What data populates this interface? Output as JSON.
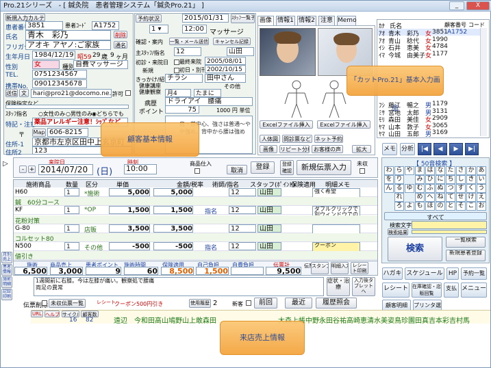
{
  "window": {
    "app": "Pro.21シリーズ",
    "title": "- [ 鍼灸院　患者管理システム「鍼灸Pro.21」 ]",
    "minimize": "_",
    "close": "X"
  },
  "topbar": {
    "register_button": "新規入力カルテ"
  },
  "patient": {
    "no_label": "患者番号",
    "no": "3851",
    "patient_code_label": "患者ｺｰﾄﾞ",
    "patient_code": "A1752",
    "delete": "削除",
    "name_label": "氏名",
    "name": "青木　彩乃",
    "nickname": "通名",
    "furigana_label": "フリガナ",
    "furigana": "アオキ アヤノ:ご家族",
    "birth_label": "生年月日",
    "birth": "1984/12/19",
    "era": "昭59",
    "age": "29",
    "age_unit": "歳",
    "month": "9",
    "month_unit": "ヶ月",
    "sex_label": "性別",
    "sex": "女",
    "category_label": "種別",
    "category": "自費マッサージ",
    "tel_label": "TEL.",
    "tel": "0751234567",
    "mobile_label": "携帯No.",
    "mobile": "09012345678",
    "email_btn": "送信",
    "text_btn": "文",
    "email": "hari@pro21@docomo.ne.jp",
    "permit": "許可",
    "insurance_label": "保険指定など",
    "staff_label": "ｽﾀｯﾌ指名",
    "staff_options": [
      "女性のみ",
      "男性のみ",
      "どちらでも"
    ],
    "alert_label": "特記・注意",
    "alert": "薬品アレルギー注意！ｼｯﾌﾟなど",
    "zip_label": "〒",
    "map": "Map",
    "zip": "606-8215",
    "address_label": "住所-1",
    "address1": "京都市左京区田中上玄京町",
    "address_label2": "住所2",
    "address2": "123"
  },
  "reservation": {
    "reserve_btn": "予約状況",
    "date": "2015/01/31",
    "time": "12:00",
    "menu": "マッサージ",
    "staff_btn": "ｽﾀｯﾌ一覧予約",
    "confirm_label": "確認・案内",
    "mail_send": "一覧・メール送信",
    "cancel": "キャンセル記録",
    "main_staff_label": "主ｽﾀｯﾌ/指名",
    "main_staff_no": "12",
    "main_staff": "山田",
    "first_visit_label": "初診・来院日",
    "first_visit_chk": "最終来院",
    "first_visit": "2005/08/01",
    "new_label": "新規",
    "first": "初日・別刊",
    "last": "2002/10/15",
    "trigger_label": "きっかけ/紹介",
    "trigger": "チラシ",
    "referrer": "田中さん",
    "seminar1": "健康講座",
    "seminar2": "健康観察",
    "col_label": "その他",
    "month_sel": "月4",
    "freq": "たまに",
    "symptom_label": "病歴",
    "symptom": "ドライアイ　腰痛",
    "point_label": "ポイント",
    "points": "75",
    "unit_price": "1000 円 単位",
    "memo_label": "基本情報",
    "memo_text": "肩・首中心、強さは普通〜やや強め。背中から腰は強め"
  },
  "images_tabs": [
    "画像",
    "情報1",
    "情報2",
    "注意",
    "Memo"
  ],
  "images_panel": {
    "excel1": "Excelファイル挿入",
    "excel2": "Excelファイル挿入",
    "body_btn": "人体図",
    "qa_btn": "問診票など",
    "net": "ネット予約",
    "img_btn": "画像",
    "repeat": "リピート分析",
    "feedback": "お客様の声",
    "enlarge": "拡大"
  },
  "customer_list": {
    "header_name": "氏名",
    "header_no": "顧客番号",
    "header_code": "コード",
    "items": [
      {
        "kana": "ｱｵ",
        "name": "青木　彩乃",
        "g": "女",
        "no": "3851",
        "code": "A1752"
      },
      {
        "kana": "ｱｵ",
        "name": "青山　稔代",
        "g": "女",
        "no": "1990"
      },
      {
        "kana": "ｲｼ",
        "name": "石井　恵美",
        "g": "女",
        "no": "4784"
      },
      {
        "kana": "ｲﾏ",
        "name": "今城　由美子",
        "g": "女",
        "no": "1177"
      },
      {
        "kana": "",
        "name": "",
        "g": "",
        "no": ""
      },
      {
        "kana": "",
        "name": "",
        "g": "",
        "no": ""
      },
      {
        "kana": "",
        "name": "",
        "g": "",
        "no": ""
      },
      {
        "kana": "",
        "name": "",
        "g": "",
        "no": ""
      },
      {
        "kana": "",
        "name": "",
        "g": "",
        "no": ""
      },
      {
        "kana": "",
        "name": "",
        "g": "",
        "no": ""
      },
      {
        "kana": "ﾌｼ",
        "name": "藤江　暢之",
        "g": "男",
        "no": "1179"
      },
      {
        "kana": "ﾐｻ",
        "name": "宮地　太郎",
        "g": "男",
        "no": "3131"
      },
      {
        "kana": "ﾓﾘ",
        "name": "森田　美佳",
        "g": "女",
        "no": "2909"
      },
      {
        "kana": "ﾔﾏ",
        "name": "山本　敦子",
        "g": "女",
        "no": "3065"
      },
      {
        "kana": "ﾔﾏ",
        "name": "山田　五郎",
        "g": "男",
        "no": "3169"
      }
    ],
    "memo": "メモ",
    "analysis": "分析",
    "first": "|◀",
    "prev": "◀",
    "next": "▶",
    "last": "▶|"
  },
  "kana_panel": {
    "title": "【 50音検索 】",
    "rows": [
      [
        "わ",
        "ら",
        "や",
        "ま",
        "は",
        "な",
        "た",
        "さ",
        "か",
        "あ"
      ],
      [
        "を",
        "り",
        "",
        "み",
        "ひ",
        "に",
        "ち",
        "し",
        "き",
        "い"
      ],
      [
        "ん",
        "る",
        "ゆ",
        "む",
        "ふ",
        "ぬ",
        "つ",
        "す",
        "く",
        "う"
      ],
      [
        "",
        "れ",
        "",
        "め",
        "へ",
        "ね",
        "て",
        "せ",
        "け",
        "え"
      ],
      [
        "",
        "ろ",
        "よ",
        "も",
        "ほ",
        "の",
        "と",
        "そ",
        "こ",
        "お"
      ]
    ],
    "all": "すべて",
    "search_text": "検索文字",
    "search_result": "検索結果",
    "search": "検索",
    "simple": "一覧検索",
    "new": "新規患者登録"
  },
  "right_buttons": {
    "hagaki": "ハガキ",
    "schedule": "スケジュール",
    "hp": "HP",
    "yoyaku": "予約一覧",
    "receipt": "レシート",
    "receipt_sub": "印刷",
    "ledger": "在庫確認・店販回覧",
    "payment": "支払",
    "menu": "メニュー",
    "staff": "顧客明細",
    "print": "プリンタ選択"
  },
  "visit": {
    "visit_date_label": "来院日",
    "visit_date": "2014/07/20",
    "dow": "(日)",
    "time_label": "時刻",
    "time": "10:00",
    "product_label": "商品仕入",
    "cancel": "取消",
    "register": "登録",
    "check": "登録確認",
    "new_slip": "新規伝票入力",
    "unpaid": "未収"
  },
  "line_header": {
    "item": "施術商品",
    "qty": "数量",
    "kind": "区分",
    "unit": "単価",
    "amount": "金額/税率",
    "staff": "術師/指名",
    "fee": "スタッフ(ﾎﾟｲﾝﾄ)",
    "insurance": "保険適用",
    "memo": "明細メモ"
  },
  "lines": [
    {
      "code": "H60",
      "qty": "1",
      "kind": "*施術",
      "unit": "5,000",
      "amount": "5,000",
      "nomination": "",
      "staff_no": "12",
      "staff": "山田",
      "memo": "強く希望",
      "memo2": "主に右肩"
    },
    {
      "code": "鍼　60分コース",
      "qty": "",
      "kind": "",
      "unit": "",
      "amount": "",
      "nomination": "",
      "staff_no": "",
      "staff": "",
      "memo": ""
    },
    {
      "code": "KF",
      "qty": "1",
      "kind": "*OP",
      "unit": "1,500",
      "amount": "1,500",
      "nomination": "指名",
      "staff_no": "12",
      "staff": "山田",
      "memo": "ダブルクリックで別ウィンドウでの入力も可能です。"
    },
    {
      "code": "花粉対策",
      "qty": "",
      "kind": "",
      "unit": "",
      "amount": "",
      "nomination": "",
      "staff_no": "",
      "staff": "",
      "memo": ""
    },
    {
      "code": "G-80",
      "qty": "1",
      "kind": "店販",
      "unit": "3,500",
      "amount": "3,500",
      "nomination": "",
      "staff_no": "12",
      "staff": "山田",
      "memo": ""
    },
    {
      "code": "コルセット80",
      "qty": "",
      "kind": "",
      "unit": "",
      "amount": "",
      "nomination": "",
      "staff_no": "",
      "staff": "",
      "memo": ""
    },
    {
      "code": "N500",
      "qty": "1",
      "kind": "その他",
      "unit": "-500",
      "amount": "-500",
      "nomination": "指名",
      "staff_no": "12",
      "staff": "山田",
      "memo": "クーポン"
    },
    {
      "code": "値引き",
      "qty": "",
      "kind": "",
      "unit": "",
      "amount": "",
      "nomination": "",
      "staff_no": "",
      "staff": "",
      "memo": ""
    }
  ],
  "totals": {
    "t_label": "施術",
    "t": "6,500",
    "p_label": "商品売上",
    "p": "3,000",
    "pt_label": "患者ポイント",
    "pt": "9",
    "cnt_label": "施術時間",
    "cnt": "60",
    "ins_label": "保険適用",
    "ins": "8,500",
    "self_label": "自己負担",
    "self": "1,500",
    "self2_label": "自費負担",
    "self2": "",
    "total_label": "伝票計",
    "total": "9,500",
    "discount": "伝票計値引",
    "stamp": "スタンプ",
    "detail": "明細入力",
    "receipt": "レシート印刷"
  },
  "memo_area": {
    "text": "1週間前に右膝。今は左膝が痛い。観察処で腰痛\n両足の異常",
    "symptom": "症状・治療",
    "next": "次回",
    "next2": "入力後タブレットへ"
  },
  "footer": {
    "slip_label": "伝票削除",
    "unpaid_list": "未収伝票一覧",
    "receipt": "レシート",
    "coupon": "クーポン500円引き",
    "hist": "使用履歴",
    "hist_n": "2",
    "new_reg": "新客",
    "prev": "前回",
    "near": "最近",
    "history": "履歴照会"
  },
  "left_tabs": [
    "月別 売上",
    "患者 情報",
    "施術 明細",
    "記録 印刷"
  ],
  "bottom": {
    "url": "URL",
    "help": "ヘルプ",
    "cycle": "サイクル",
    "pcnt": "顧客数",
    "n1": "16",
    "n2": "82",
    "names": [
      "遠辺",
      "今和田",
      "高山鳩",
      "野山上",
      "敢森田",
      "",
      "",
      "",
      "大森上",
      "帳中野",
      "永田谷",
      "祐高崎",
      "恵清水",
      "美姿鳥",
      "珍園田",
      "真吉本",
      "彩吉村",
      "馬"
    ]
  },
  "balloons": {
    "a": "「カットPro.21」基本入力画面",
    "b": "顧客基本情報",
    "c": "来店売上情報"
  }
}
